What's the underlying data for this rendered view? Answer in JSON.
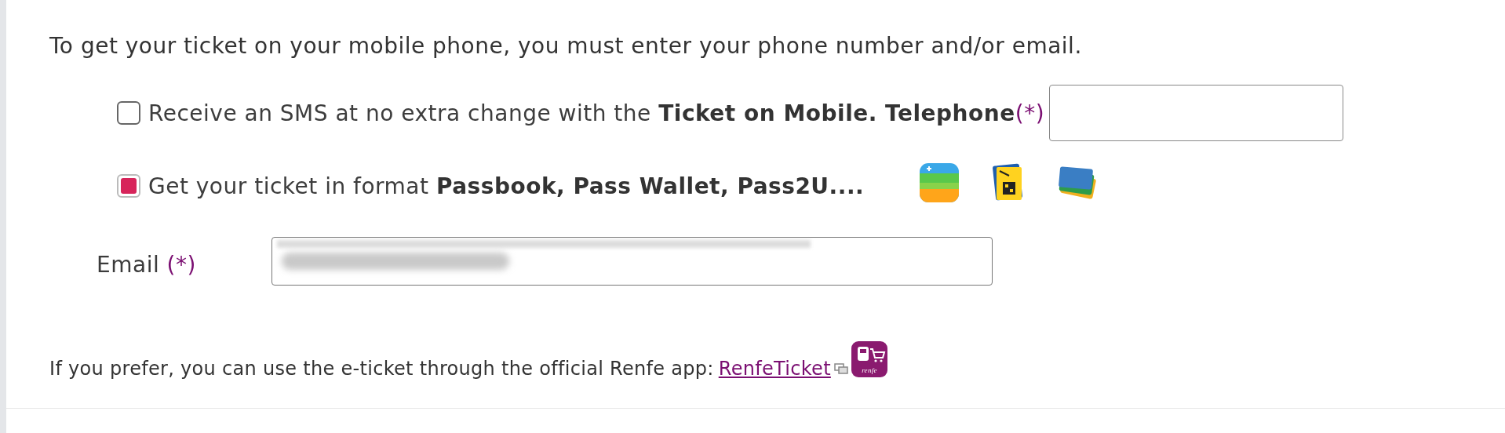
{
  "intro": "To get your ticket on your mobile phone, you must enter your phone number and/or email.",
  "options": [
    {
      "kind": "sms",
      "checked": false,
      "label": "Receive an SMS at no extra change with the **Ticket on Mobile. Telephone**",
      "required_mark": "(*)",
      "field": {
        "kind": "input"
      }
    },
    {
      "kind": "wallet",
      "checked": true,
      "label": "Get your ticket in format **Passbook, Pass Wallet, Pass2U....**",
      "icons": [
        {
          "kind": "wallet"
        },
        {
          "kind": "passwallet"
        },
        {
          "kind": "pass2u"
        }
      ]
    }
  ],
  "email": {
    "label": "Email",
    "required_mark": "(*)",
    "value_redacted": true
  },
  "footer": {
    "text": "If you prefer, you can use the e-ticket through the official Renfe app:",
    "link": "RenfeTicket",
    "app_icon_label": "renfe"
  }
}
